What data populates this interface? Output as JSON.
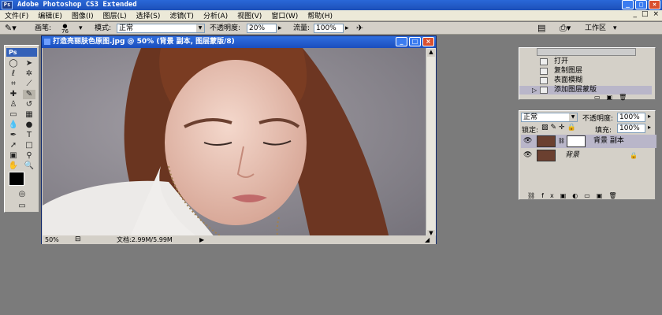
{
  "app": {
    "title": "Adobe Photoshop CS3 Extended",
    "logo": "Ps"
  },
  "window_buttons": {
    "minimize": "_",
    "maximize": "□",
    "close": "×"
  },
  "menu": [
    "文件(F)",
    "编辑(E)",
    "图像(I)",
    "图层(L)",
    "选择(S)",
    "滤镜(T)",
    "分析(A)",
    "视图(V)",
    "窗口(W)",
    "帮助(H)"
  ],
  "options": {
    "brush_label": "画笔:",
    "brush_size": "76",
    "mode_label": "模式:",
    "mode_value": "正常",
    "opacity_label": "不透明度:",
    "opacity_value": "20%",
    "flow_label": "流量:",
    "flow_value": "100%",
    "workspace_label": "工作区"
  },
  "toolbox": {
    "badge": "Ps",
    "text_tool": "T"
  },
  "document": {
    "title": "打造亮丽肤色原图.jpg @ 50% (背景 副本, 图层蒙版/8)",
    "zoom": "50%",
    "doc_size": "文档:2.99M/5.99M"
  },
  "history": {
    "items": [
      "打开",
      "复制图层",
      "表面模糊",
      "添加图层蒙版"
    ]
  },
  "layers": {
    "blend_mode": "正常",
    "opacity_label": "不透明度:",
    "opacity_value": "100%",
    "lock_label": "锁定:",
    "fill_label": "填充:",
    "fill_value": "100%",
    "rows": [
      {
        "name": "背景 副本"
      },
      {
        "name": "背景"
      }
    ]
  }
}
